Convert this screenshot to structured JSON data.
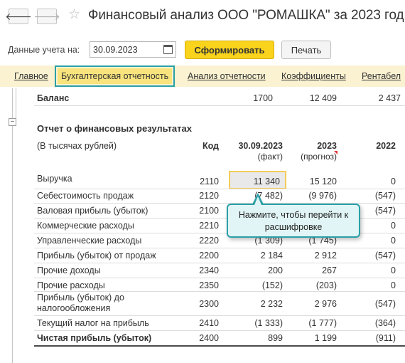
{
  "header": {
    "back_glyph": "🡐",
    "forward_glyph": "🡒",
    "star_glyph": "☆",
    "title": "Финансовый анализ ООО \"РОМАШКА\" за 2023 год"
  },
  "toolbar": {
    "date_label": "Данные учета на:",
    "date_value": "30.09.2023",
    "generate_label": "Сформировать",
    "print_label": "Печать"
  },
  "tabs": [
    {
      "label": "Главное"
    },
    {
      "label": "Бухгалтерская отчетность"
    },
    {
      "label": "Анализ отчетности"
    },
    {
      "label": "Коэффициенты"
    },
    {
      "label": "Рентабел"
    }
  ],
  "balance": {
    "label": "Баланс",
    "code": "1700",
    "y2023": "12 409",
    "y2022": "2 437"
  },
  "report": {
    "collapse_glyph": "−",
    "section_title": "Отчет о финансовых результатах",
    "units": "(В тысячах рублей)",
    "col_code": "Код",
    "col_date": "30.09.2023",
    "col_date_sub": "(факт)",
    "col_2023": "2023",
    "col_2023_sub": "(прогноз)",
    "col_2022": "2022",
    "rows": [
      {
        "label": "Выручка",
        "code": "2110",
        "fact": "11 340",
        "forecast": "15 120",
        "prev": "0"
      },
      {
        "label": "Себестоимость продаж",
        "code": "2120",
        "fact": "(7 482)",
        "forecast": "(9 976)",
        "prev": "(547)"
      },
      {
        "label": "Валовая прибыль (убыток)",
        "code": "2100",
        "fact": "",
        "forecast": "",
        "prev": "(547)"
      },
      {
        "label": "Коммерческие расходы",
        "code": "2210",
        "fact": "",
        "forecast": "",
        "prev": "0"
      },
      {
        "label": "Управленческие расходы",
        "code": "2220",
        "fact": "(1 309)",
        "forecast": "(1 745)",
        "prev": "0"
      },
      {
        "label": "Прибыль (убыток) от продаж",
        "code": "2200",
        "fact": "2 184",
        "forecast": "2 912",
        "prev": "(547)"
      },
      {
        "label": "Прочие доходы",
        "code": "2340",
        "fact": "200",
        "forecast": "267",
        "prev": "0"
      },
      {
        "label": "Прочие расходы",
        "code": "2350",
        "fact": "(152)",
        "forecast": "(203)",
        "prev": "0"
      },
      {
        "label": "Прибыль (убыток) до",
        "label2": "налогообложения",
        "code": "2300",
        "fact": "2 232",
        "forecast": "2 976",
        "prev": "(547)"
      },
      {
        "label": "Текущий налог на прибыль",
        "code": "2410",
        "fact": "(1 333)",
        "forecast": "(1 777)",
        "prev": "(364)"
      },
      {
        "label": "Чистая прибыль (убыток)",
        "code": "2400",
        "fact": "899",
        "forecast": "1 199",
        "prev": "(911)"
      }
    ]
  },
  "tooltip": {
    "line1": "Нажмите, чтобы перейти к",
    "line2": "расшифровке"
  },
  "colors": {
    "accent_yellow": "#f9d31c",
    "tab_bar": "#fbf2d1",
    "active_tab": "#f8e37d",
    "teal_outline": "#2aa0a7",
    "tooltip_bg": "#e1f5f6"
  }
}
